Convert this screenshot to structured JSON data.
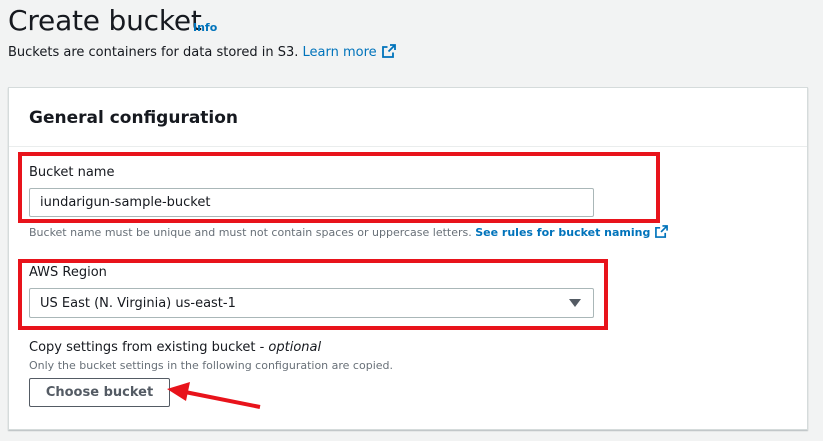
{
  "header": {
    "title": "Create bucket",
    "info_label": "Info",
    "subtitle": "Buckets are containers for data stored in S3.",
    "learn_more": "Learn more"
  },
  "general_config": {
    "title": "General configuration",
    "bucket_name": {
      "label": "Bucket name",
      "value": "iundarigun-sample-bucket",
      "hint": "Bucket name must be unique and must not contain spaces or uppercase letters.",
      "hint_link": "See rules for bucket naming"
    },
    "region": {
      "label": "AWS Region",
      "value": "US East (N. Virginia) us-east-1"
    },
    "copy_settings": {
      "label": "Copy settings from existing bucket - ",
      "optional": "optional",
      "description": "Only the bucket settings in the following configuration are copied.",
      "button": "Choose bucket"
    }
  },
  "colors": {
    "link": "#0073bb",
    "annotation": "#e8131b",
    "background": "#f2f3f3"
  },
  "icons": [
    "external-link-icon",
    "dropdown-caret-icon"
  ]
}
